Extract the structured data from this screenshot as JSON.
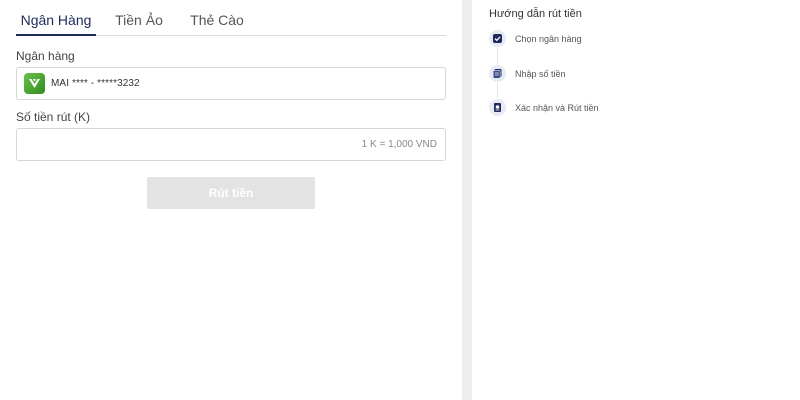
{
  "tabs": [
    {
      "label": "Ngân Hàng",
      "active": true
    },
    {
      "label": "Tiền Ảo",
      "active": false
    },
    {
      "label": "Thẻ Cào",
      "active": false
    }
  ],
  "form": {
    "bank_label": "Ngân hàng",
    "bank_value": "MAI **** - *****3232",
    "amount_label": "Số tiền rút (K)",
    "amount_placeholder": "1 K = 1,000 VND",
    "amount_value": "",
    "submit_label": "Rút tiền"
  },
  "guide": {
    "title": "Hướng dẫn rút tiền",
    "steps": [
      {
        "label": "Chọn ngân hàng",
        "icon": "checkmark-icon"
      },
      {
        "label": "Nhập số tiền",
        "icon": "document-icon"
      },
      {
        "label": "Xác nhận và Rút tiền",
        "icon": "confirm-icon"
      }
    ]
  },
  "colors": {
    "accent": "#1f2a5c",
    "bank_logo": "#4aa832",
    "button_disabled": "#e3e3e3"
  }
}
